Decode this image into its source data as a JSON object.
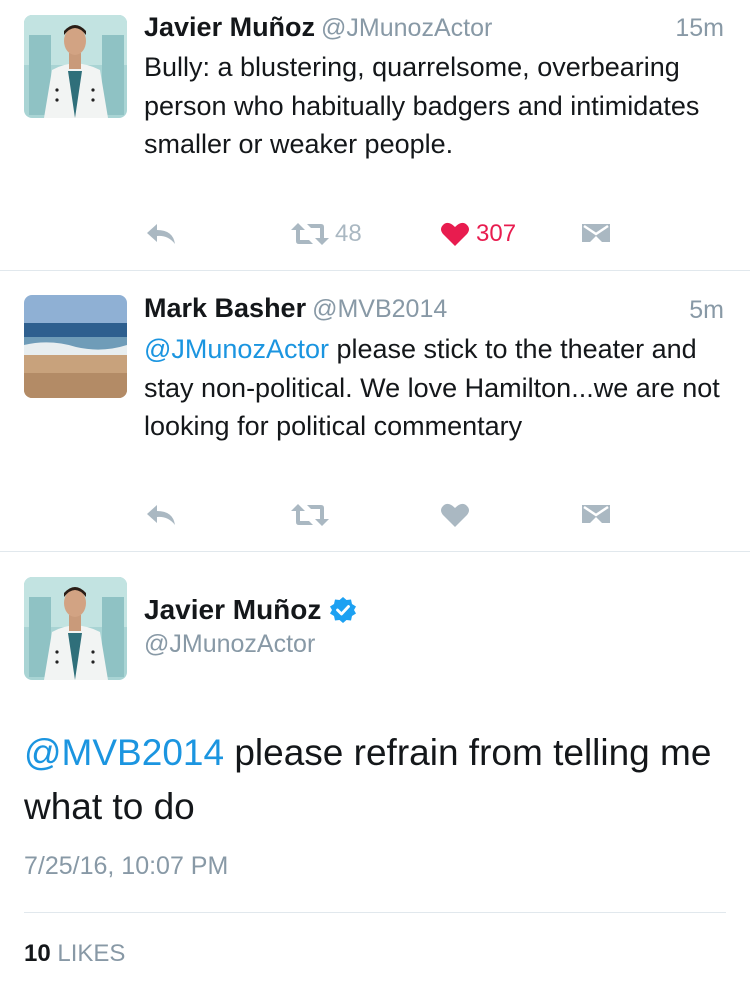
{
  "tweets": [
    {
      "name": "Javier Muñoz",
      "handle": "@JMunozActor",
      "time": "15m",
      "text": "Bully: a blustering, quarrelsome, overbearing person who habitually badgers and intimidates smaller or weaker people.",
      "retweets": "48",
      "likes": "307",
      "liked": true,
      "avatar_icon": "portrait-avatar"
    },
    {
      "name": "Mark Basher",
      "handle": "@MVB2014",
      "time": "5m",
      "mention": "@JMunozActor",
      "text": " please stick to the theater and stay non-political. We love Hamilton...we are not looking for political commentary",
      "retweets": "",
      "likes": "",
      "liked": false,
      "avatar_icon": "beach-avatar"
    }
  ],
  "main_tweet": {
    "name": "Javier Muñoz",
    "handle": "@JMunozActor",
    "verified_icon": "verified-badge-icon",
    "mention": "@MVB2014",
    "text": " please refrain from telling me what to do",
    "timestamp": "7/25/16, 10:07 PM",
    "likes_count": "10",
    "likes_label": "LIKES"
  },
  "colors": {
    "link": "#1b95e0",
    "muted": "#8899a6",
    "icon": "#aab8c2",
    "like": "#e81c4f",
    "divider": "#e1e8ed"
  }
}
